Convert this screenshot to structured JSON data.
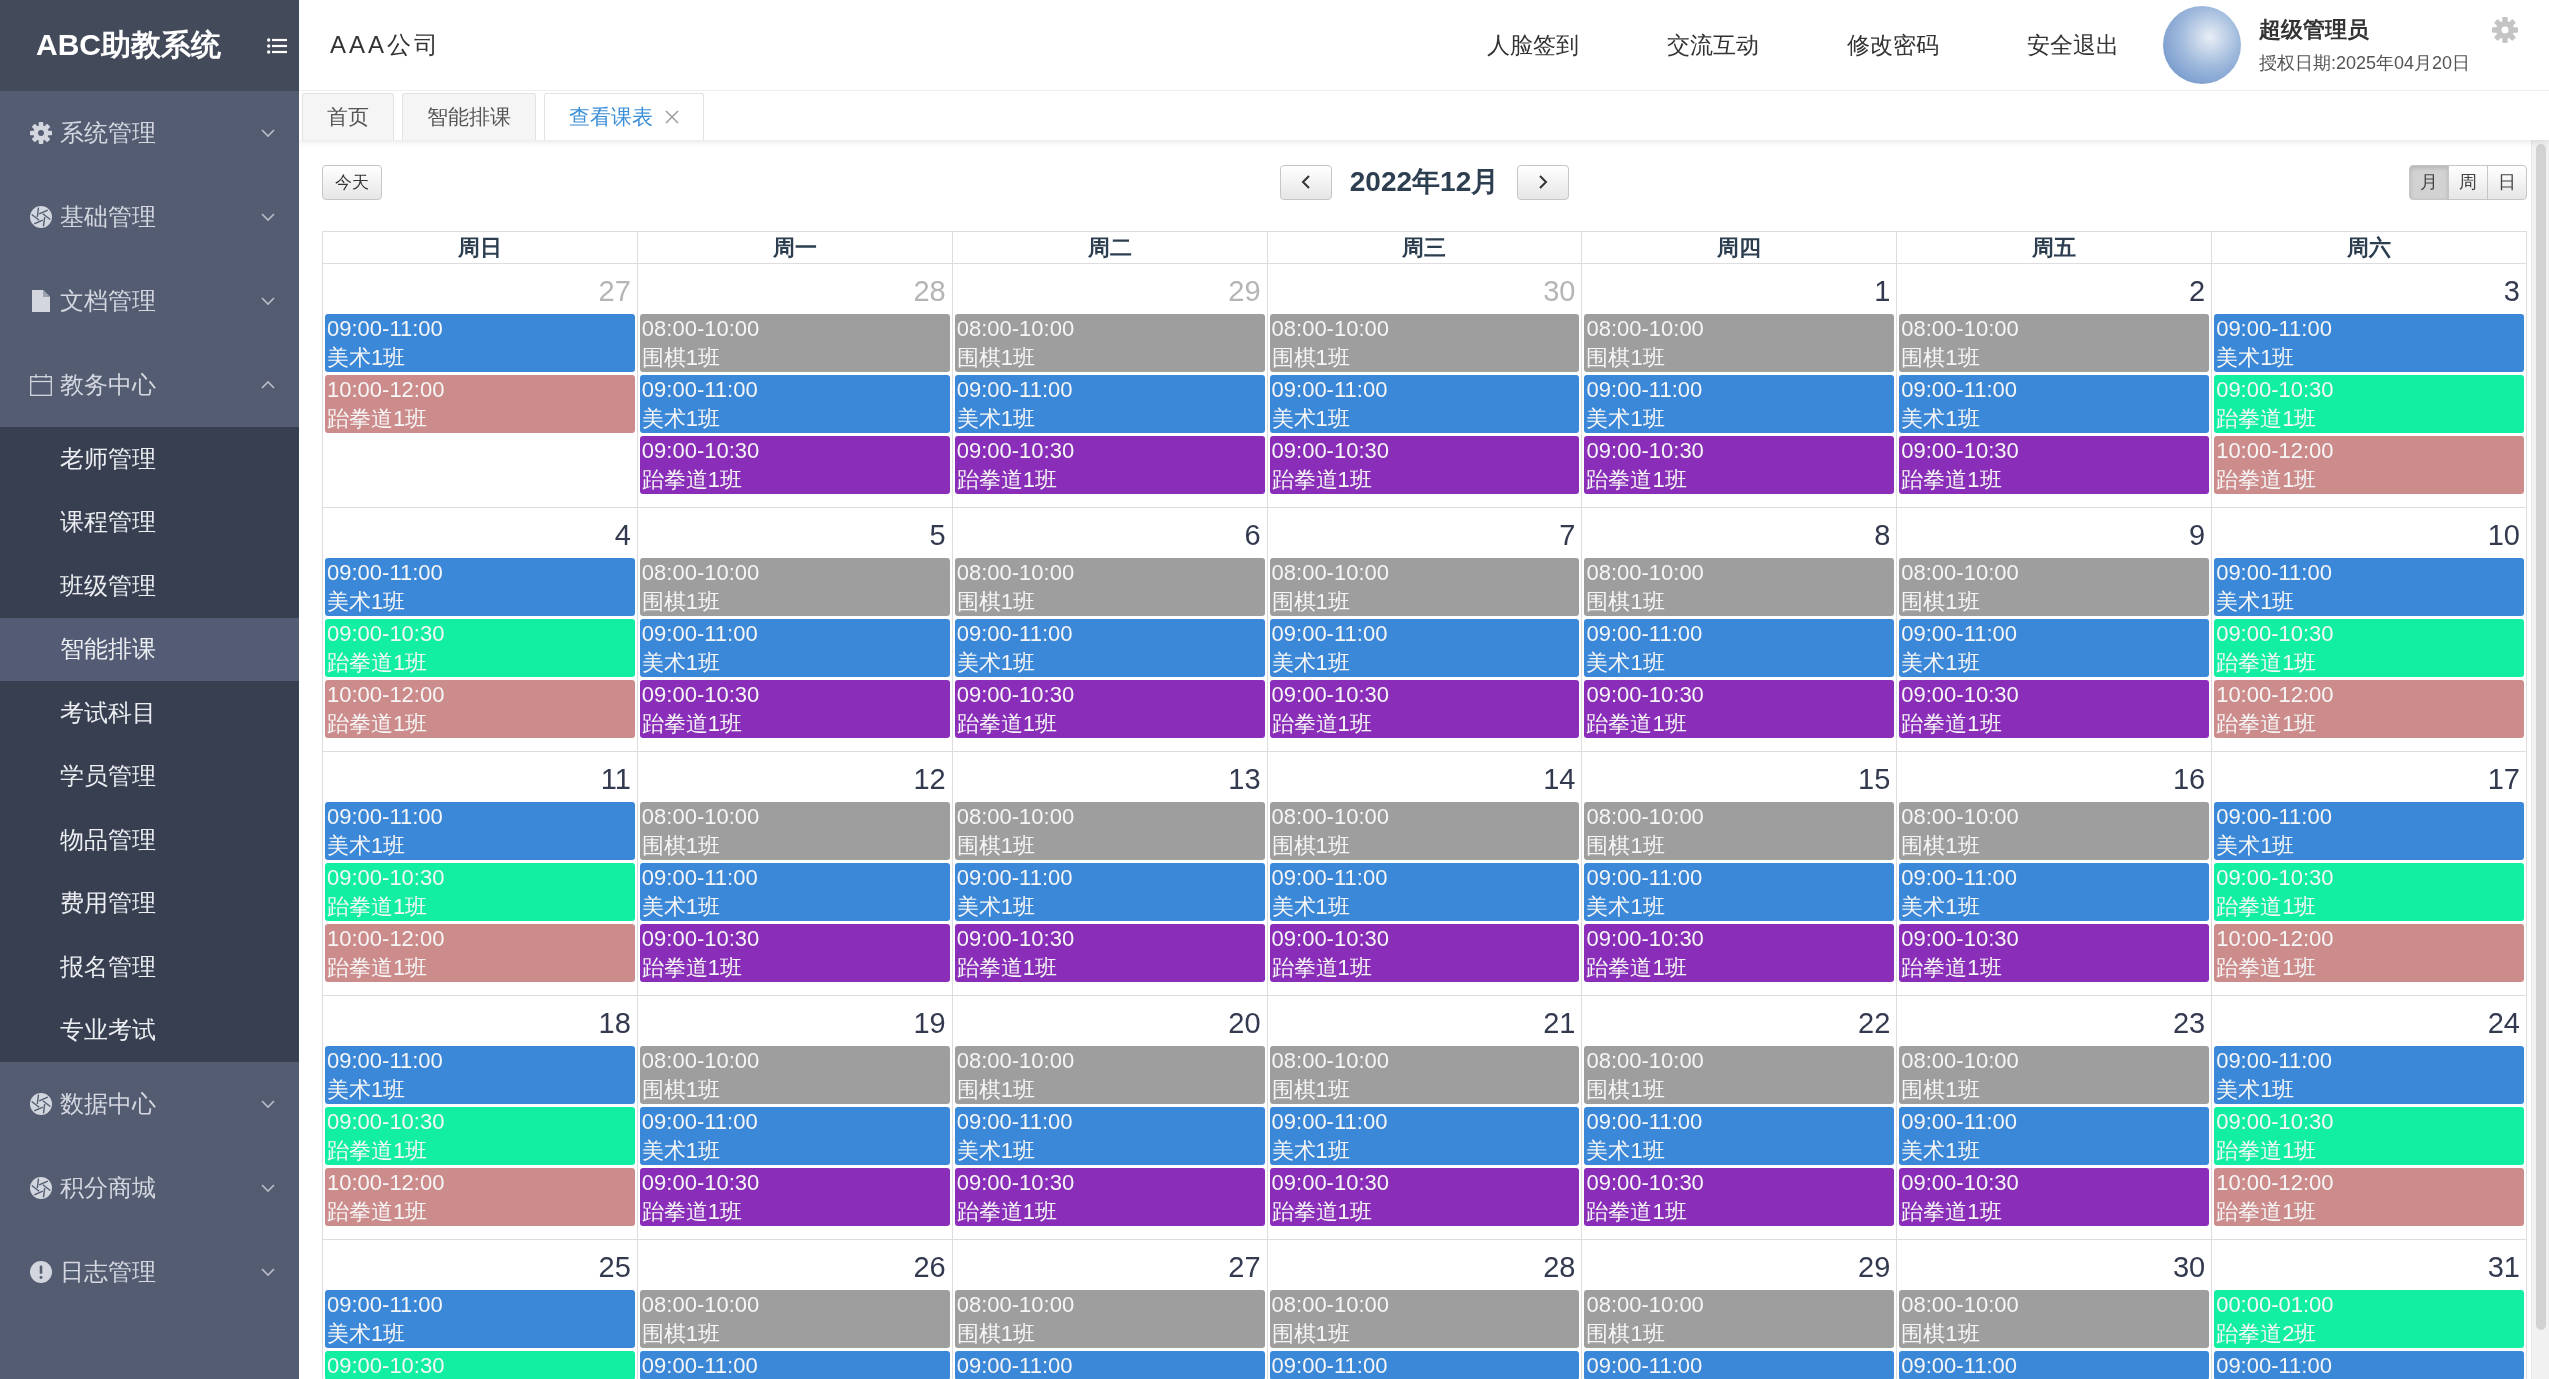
{
  "sidebar": {
    "logo": "ABC助教系统",
    "groups": [
      {
        "label": "系统管理",
        "expanded": false
      },
      {
        "label": "基础管理",
        "expanded": false
      },
      {
        "label": "文档管理",
        "expanded": false
      },
      {
        "label": "教务中心",
        "expanded": true,
        "children": [
          {
            "label": "老师管理",
            "selected": false
          },
          {
            "label": "课程管理",
            "selected": false
          },
          {
            "label": "班级管理",
            "selected": false
          },
          {
            "label": "智能排课",
            "selected": true
          },
          {
            "label": "考试科目",
            "selected": false
          },
          {
            "label": "学员管理",
            "selected": false
          },
          {
            "label": "物品管理",
            "selected": false
          },
          {
            "label": "费用管理",
            "selected": false
          },
          {
            "label": "报名管理",
            "selected": false
          },
          {
            "label": "专业考试",
            "selected": false
          }
        ]
      },
      {
        "label": "数据中心",
        "expanded": false
      },
      {
        "label": "积分商城",
        "expanded": false
      },
      {
        "label": "日志管理",
        "expanded": false
      }
    ]
  },
  "header": {
    "company": "AAA公司",
    "nav": [
      "人脸签到",
      "交流互动",
      "修改密码",
      "安全退出"
    ],
    "user": {
      "name": "超级管理员",
      "license": "授权日期:2025年04月20日"
    }
  },
  "tabs": [
    {
      "label": "首页",
      "selected": false,
      "closable": false
    },
    {
      "label": "智能排课",
      "selected": false,
      "closable": false
    },
    {
      "label": "查看课表",
      "selected": true,
      "closable": true
    }
  ],
  "toolbar": {
    "today": "今天",
    "title": "2022年12月",
    "views": [
      {
        "label": "月",
        "selected": true
      },
      {
        "label": "周",
        "selected": false
      },
      {
        "label": "日",
        "selected": false
      }
    ]
  },
  "calendar": {
    "weekdays": [
      "周日",
      "周一",
      "周二",
      "周三",
      "周四",
      "周五",
      "周六"
    ],
    "weeks": [
      {
        "days": [
          {
            "date": "27",
            "other_month": true,
            "events": [
              {
                "time": "09:00-11:00",
                "title": "美术1班",
                "color": "#3b88d9"
              },
              {
                "time": "10:00-12:00",
                "title": "跆拳道1班",
                "color": "#cd8c8c"
              }
            ]
          },
          {
            "date": "28",
            "other_month": true,
            "events": [
              {
                "time": "08:00-10:00",
                "title": "围棋1班",
                "color": "#9e9e9e"
              },
              {
                "time": "09:00-11:00",
                "title": "美术1班",
                "color": "#3b88d9"
              },
              {
                "time": "09:00-10:30",
                "title": "跆拳道1班",
                "color": "#8a2db8"
              }
            ]
          },
          {
            "date": "29",
            "other_month": true,
            "events": [
              {
                "time": "08:00-10:00",
                "title": "围棋1班",
                "color": "#9e9e9e"
              },
              {
                "time": "09:00-11:00",
                "title": "美术1班",
                "color": "#3b88d9"
              },
              {
                "time": "09:00-10:30",
                "title": "跆拳道1班",
                "color": "#8a2db8"
              }
            ]
          },
          {
            "date": "30",
            "other_month": true,
            "events": [
              {
                "time": "08:00-10:00",
                "title": "围棋1班",
                "color": "#9e9e9e"
              },
              {
                "time": "09:00-11:00",
                "title": "美术1班",
                "color": "#3b88d9"
              },
              {
                "time": "09:00-10:30",
                "title": "跆拳道1班",
                "color": "#8a2db8"
              }
            ]
          },
          {
            "date": "1",
            "other_month": false,
            "events": [
              {
                "time": "08:00-10:00",
                "title": "围棋1班",
                "color": "#9e9e9e"
              },
              {
                "time": "09:00-11:00",
                "title": "美术1班",
                "color": "#3b88d9"
              },
              {
                "time": "09:00-10:30",
                "title": "跆拳道1班",
                "color": "#8a2db8"
              }
            ]
          },
          {
            "date": "2",
            "other_month": false,
            "events": [
              {
                "time": "08:00-10:00",
                "title": "围棋1班",
                "color": "#9e9e9e"
              },
              {
                "time": "09:00-11:00",
                "title": "美术1班",
                "color": "#3b88d9"
              },
              {
                "time": "09:00-10:30",
                "title": "跆拳道1班",
                "color": "#8a2db8"
              }
            ]
          },
          {
            "date": "3",
            "other_month": false,
            "events": [
              {
                "time": "09:00-11:00",
                "title": "美术1班",
                "color": "#3b88d9"
              },
              {
                "time": "09:00-10:30",
                "title": "跆拳道1班",
                "color": "#12eea2"
              },
              {
                "time": "10:00-12:00",
                "title": "跆拳道1班",
                "color": "#cd8c8c"
              }
            ]
          }
        ]
      },
      {
        "days": [
          {
            "date": "4",
            "other_month": false,
            "events": [
              {
                "time": "09:00-11:00",
                "title": "美术1班",
                "color": "#3b88d9"
              },
              {
                "time": "09:00-10:30",
                "title": "跆拳道1班",
                "color": "#12eea2"
              },
              {
                "time": "10:00-12:00",
                "title": "跆拳道1班",
                "color": "#cd8c8c"
              }
            ]
          },
          {
            "date": "5",
            "other_month": false,
            "events": [
              {
                "time": "08:00-10:00",
                "title": "围棋1班",
                "color": "#9e9e9e"
              },
              {
                "time": "09:00-11:00",
                "title": "美术1班",
                "color": "#3b88d9"
              },
              {
                "time": "09:00-10:30",
                "title": "跆拳道1班",
                "color": "#8a2db8"
              }
            ]
          },
          {
            "date": "6",
            "other_month": false,
            "events": [
              {
                "time": "08:00-10:00",
                "title": "围棋1班",
                "color": "#9e9e9e"
              },
              {
                "time": "09:00-11:00",
                "title": "美术1班",
                "color": "#3b88d9"
              },
              {
                "time": "09:00-10:30",
                "title": "跆拳道1班",
                "color": "#8a2db8"
              }
            ]
          },
          {
            "date": "7",
            "other_month": false,
            "events": [
              {
                "time": "08:00-10:00",
                "title": "围棋1班",
                "color": "#9e9e9e"
              },
              {
                "time": "09:00-11:00",
                "title": "美术1班",
                "color": "#3b88d9"
              },
              {
                "time": "09:00-10:30",
                "title": "跆拳道1班",
                "color": "#8a2db8"
              }
            ]
          },
          {
            "date": "8",
            "other_month": false,
            "events": [
              {
                "time": "08:00-10:00",
                "title": "围棋1班",
                "color": "#9e9e9e"
              },
              {
                "time": "09:00-11:00",
                "title": "美术1班",
                "color": "#3b88d9"
              },
              {
                "time": "09:00-10:30",
                "title": "跆拳道1班",
                "color": "#8a2db8"
              }
            ]
          },
          {
            "date": "9",
            "other_month": false,
            "events": [
              {
                "time": "08:00-10:00",
                "title": "围棋1班",
                "color": "#9e9e9e"
              },
              {
                "time": "09:00-11:00",
                "title": "美术1班",
                "color": "#3b88d9"
              },
              {
                "time": "09:00-10:30",
                "title": "跆拳道1班",
                "color": "#8a2db8"
              }
            ]
          },
          {
            "date": "10",
            "other_month": false,
            "events": [
              {
                "time": "09:00-11:00",
                "title": "美术1班",
                "color": "#3b88d9"
              },
              {
                "time": "09:00-10:30",
                "title": "跆拳道1班",
                "color": "#12eea2"
              },
              {
                "time": "10:00-12:00",
                "title": "跆拳道1班",
                "color": "#cd8c8c"
              }
            ]
          }
        ]
      },
      {
        "days": [
          {
            "date": "11",
            "other_month": false,
            "events": [
              {
                "time": "09:00-11:00",
                "title": "美术1班",
                "color": "#3b88d9"
              },
              {
                "time": "09:00-10:30",
                "title": "跆拳道1班",
                "color": "#12eea2"
              },
              {
                "time": "10:00-12:00",
                "title": "跆拳道1班",
                "color": "#cd8c8c"
              }
            ]
          },
          {
            "date": "12",
            "other_month": false,
            "events": [
              {
                "time": "08:00-10:00",
                "title": "围棋1班",
                "color": "#9e9e9e"
              },
              {
                "time": "09:00-11:00",
                "title": "美术1班",
                "color": "#3b88d9"
              },
              {
                "time": "09:00-10:30",
                "title": "跆拳道1班",
                "color": "#8a2db8"
              }
            ]
          },
          {
            "date": "13",
            "other_month": false,
            "events": [
              {
                "time": "08:00-10:00",
                "title": "围棋1班",
                "color": "#9e9e9e"
              },
              {
                "time": "09:00-11:00",
                "title": "美术1班",
                "color": "#3b88d9"
              },
              {
                "time": "09:00-10:30",
                "title": "跆拳道1班",
                "color": "#8a2db8"
              }
            ]
          },
          {
            "date": "14",
            "other_month": false,
            "events": [
              {
                "time": "08:00-10:00",
                "title": "围棋1班",
                "color": "#9e9e9e"
              },
              {
                "time": "09:00-11:00",
                "title": "美术1班",
                "color": "#3b88d9"
              },
              {
                "time": "09:00-10:30",
                "title": "跆拳道1班",
                "color": "#8a2db8"
              }
            ]
          },
          {
            "date": "15",
            "other_month": false,
            "events": [
              {
                "time": "08:00-10:00",
                "title": "围棋1班",
                "color": "#9e9e9e"
              },
              {
                "time": "09:00-11:00",
                "title": "美术1班",
                "color": "#3b88d9"
              },
              {
                "time": "09:00-10:30",
                "title": "跆拳道1班",
                "color": "#8a2db8"
              }
            ]
          },
          {
            "date": "16",
            "other_month": false,
            "events": [
              {
                "time": "08:00-10:00",
                "title": "围棋1班",
                "color": "#9e9e9e"
              },
              {
                "time": "09:00-11:00",
                "title": "美术1班",
                "color": "#3b88d9"
              },
              {
                "time": "09:00-10:30",
                "title": "跆拳道1班",
                "color": "#8a2db8"
              }
            ]
          },
          {
            "date": "17",
            "other_month": false,
            "events": [
              {
                "time": "09:00-11:00",
                "title": "美术1班",
                "color": "#3b88d9"
              },
              {
                "time": "09:00-10:30",
                "title": "跆拳道1班",
                "color": "#12eea2"
              },
              {
                "time": "10:00-12:00",
                "title": "跆拳道1班",
                "color": "#cd8c8c"
              }
            ]
          }
        ]
      },
      {
        "days": [
          {
            "date": "18",
            "other_month": false,
            "events": [
              {
                "time": "09:00-11:00",
                "title": "美术1班",
                "color": "#3b88d9"
              },
              {
                "time": "09:00-10:30",
                "title": "跆拳道1班",
                "color": "#12eea2"
              },
              {
                "time": "10:00-12:00",
                "title": "跆拳道1班",
                "color": "#cd8c8c"
              }
            ]
          },
          {
            "date": "19",
            "other_month": false,
            "events": [
              {
                "time": "08:00-10:00",
                "title": "围棋1班",
                "color": "#9e9e9e"
              },
              {
                "time": "09:00-11:00",
                "title": "美术1班",
                "color": "#3b88d9"
              },
              {
                "time": "09:00-10:30",
                "title": "跆拳道1班",
                "color": "#8a2db8"
              }
            ]
          },
          {
            "date": "20",
            "other_month": false,
            "events": [
              {
                "time": "08:00-10:00",
                "title": "围棋1班",
                "color": "#9e9e9e"
              },
              {
                "time": "09:00-11:00",
                "title": "美术1班",
                "color": "#3b88d9"
              },
              {
                "time": "09:00-10:30",
                "title": "跆拳道1班",
                "color": "#8a2db8"
              }
            ]
          },
          {
            "date": "21",
            "other_month": false,
            "events": [
              {
                "time": "08:00-10:00",
                "title": "围棋1班",
                "color": "#9e9e9e"
              },
              {
                "time": "09:00-11:00",
                "title": "美术1班",
                "color": "#3b88d9"
              },
              {
                "time": "09:00-10:30",
                "title": "跆拳道1班",
                "color": "#8a2db8"
              }
            ]
          },
          {
            "date": "22",
            "other_month": false,
            "events": [
              {
                "time": "08:00-10:00",
                "title": "围棋1班",
                "color": "#9e9e9e"
              },
              {
                "time": "09:00-11:00",
                "title": "美术1班",
                "color": "#3b88d9"
              },
              {
                "time": "09:00-10:30",
                "title": "跆拳道1班",
                "color": "#8a2db8"
              }
            ]
          },
          {
            "date": "23",
            "other_month": false,
            "events": [
              {
                "time": "08:00-10:00",
                "title": "围棋1班",
                "color": "#9e9e9e"
              },
              {
                "time": "09:00-11:00",
                "title": "美术1班",
                "color": "#3b88d9"
              },
              {
                "time": "09:00-10:30",
                "title": "跆拳道1班",
                "color": "#8a2db8"
              }
            ]
          },
          {
            "date": "24",
            "other_month": false,
            "events": [
              {
                "time": "09:00-11:00",
                "title": "美术1班",
                "color": "#3b88d9"
              },
              {
                "time": "09:00-10:30",
                "title": "跆拳道1班",
                "color": "#12eea2"
              },
              {
                "time": "10:00-12:00",
                "title": "跆拳道1班",
                "color": "#cd8c8c"
              }
            ]
          }
        ]
      },
      {
        "days": [
          {
            "date": "25",
            "other_month": false,
            "events": [
              {
                "time": "09:00-11:00",
                "title": "美术1班",
                "color": "#3b88d9"
              },
              {
                "time": "09:00-10:30",
                "color": "#12eea2"
              }
            ]
          },
          {
            "date": "26",
            "other_month": false,
            "events": [
              {
                "time": "08:00-10:00",
                "title": "围棋1班",
                "color": "#9e9e9e"
              },
              {
                "time": "09:00-11:00",
                "color": "#3b88d9"
              }
            ]
          },
          {
            "date": "27",
            "other_month": false,
            "events": [
              {
                "time": "08:00-10:00",
                "title": "围棋1班",
                "color": "#9e9e9e"
              },
              {
                "time": "09:00-11:00",
                "color": "#3b88d9"
              }
            ]
          },
          {
            "date": "28",
            "other_month": false,
            "events": [
              {
                "time": "08:00-10:00",
                "title": "围棋1班",
                "color": "#9e9e9e"
              },
              {
                "time": "09:00-11:00",
                "color": "#3b88d9"
              }
            ]
          },
          {
            "date": "29",
            "other_month": false,
            "events": [
              {
                "time": "08:00-10:00",
                "title": "围棋1班",
                "color": "#9e9e9e"
              },
              {
                "time": "09:00-11:00",
                "color": "#3b88d9"
              }
            ]
          },
          {
            "date": "30",
            "other_month": false,
            "events": [
              {
                "time": "08:00-10:00",
                "title": "围棋1班",
                "color": "#9e9e9e"
              },
              {
                "time": "09:00-11:00",
                "color": "#3b88d9"
              }
            ]
          },
          {
            "date": "31",
            "other_month": false,
            "events": [
              {
                "time": "00:00-01:00",
                "title": "跆拳道2班",
                "color": "#12eea2"
              },
              {
                "time": "09:00-11:00",
                "color": "#3b88d9"
              }
            ]
          }
        ]
      }
    ]
  }
}
